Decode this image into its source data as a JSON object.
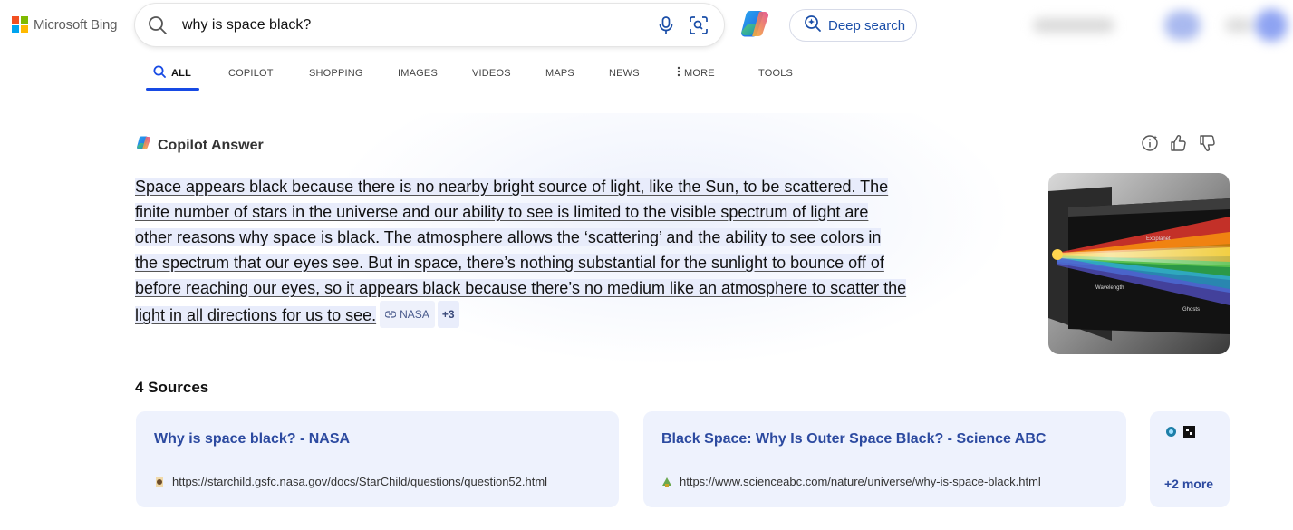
{
  "brand": {
    "name": "Microsoft Bing"
  },
  "search": {
    "query": "why is space black?"
  },
  "header": {
    "deep_search_label": "Deep search"
  },
  "tabs": [
    {
      "label": "ALL",
      "active": true
    },
    {
      "label": "COPILOT"
    },
    {
      "label": "SHOPPING"
    },
    {
      "label": "IMAGES"
    },
    {
      "label": "VIDEOS"
    },
    {
      "label": "MAPS"
    },
    {
      "label": "NEWS"
    },
    {
      "label": "MORE"
    },
    {
      "label": "TOOLS"
    }
  ],
  "answer": {
    "title": "Copilot Answer",
    "lines": [
      "Space appears black because there is no nearby bright source of light, like the Sun, to be scattered. The",
      "finite number of stars in the universe and our ability to see is limited to the visible spectrum of light are",
      "other reasons why space is black. The atmosphere allows the ‘scattering’ and the ability to see colors in",
      "the spectrum that our eyes see. But in space, there’s nothing substantial for the sunlight to bounce off of",
      "before reaching our eyes, so it appears black because there’s no medium like an atmosphere to scatter the",
      "light in all directions for us to see."
    ],
    "citation_label": "NASA",
    "citation_more": "+3",
    "image_labels": {
      "a": "Exoplanet",
      "b": "Wavelength",
      "c": "Ghosts"
    }
  },
  "sources": {
    "heading": "4 Sources",
    "cards": [
      {
        "title": "Why is space black? - NASA",
        "url": "https://starchild.gsfc.nasa.gov/docs/StarChild/questions/question52.html"
      },
      {
        "title": "Black Space: Why Is Outer Space Black? - Science ABC",
        "url": "https://www.scienceabc.com/nature/universe/why-is-space-black.html"
      }
    ],
    "more_label": "+2 more"
  },
  "colors": {
    "accent": "#174ae4",
    "link": "#2c4aa0",
    "card_bg": "#eef2fd"
  }
}
